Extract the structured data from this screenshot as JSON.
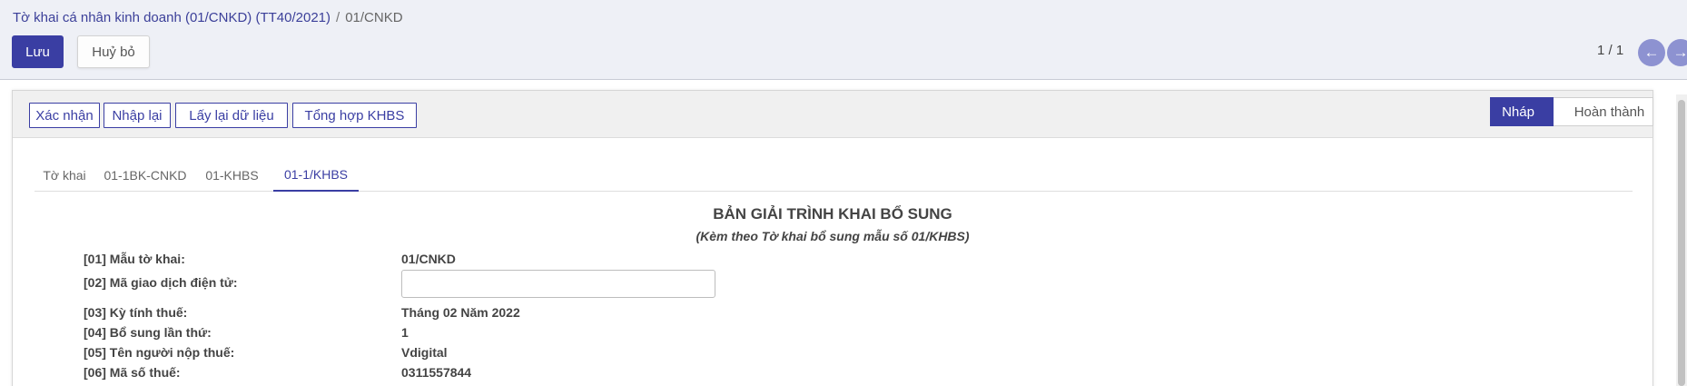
{
  "breadcrumb": {
    "parent": "Tờ khai cá nhân kinh doanh (01/CNKD) (TT40/2021)",
    "separator": "/",
    "current": "01/CNKD"
  },
  "actions": {
    "save": "Lưu",
    "discard": "Huỷ bỏ"
  },
  "pager": {
    "value": "1 / 1",
    "prev_icon": "arrow-left-icon",
    "next_icon": "arrow-right-icon"
  },
  "statusbar": {
    "buttons": [
      "Xác nhận",
      "Nhập lại",
      "Lấy lại dữ liệu",
      "Tổng hợp KHBS"
    ],
    "stages": [
      "Nháp",
      "Hoàn thành"
    ],
    "active_stage": "Nháp"
  },
  "tabs": [
    "Tờ khai",
    "01-1BK-CNKD",
    "01-KHBS",
    "01-1/KHBS"
  ],
  "active_tab": "01-1/KHBS",
  "document": {
    "title": "BẢN GIẢI TRÌNH KHAI BỔ SUNG",
    "subtitle": "(Kèm theo Tờ khai bổ sung mẫu số 01/KHBS)",
    "fields": [
      {
        "label": "[01] Mẫu tờ khai:",
        "value": "01/CNKD"
      },
      {
        "label": "[02] Mã giao dịch điện tử:",
        "value": ""
      },
      {
        "label": "[03] Kỳ tính thuế:",
        "value": "Tháng 02 Năm 2022"
      },
      {
        "label": "[04] Bổ sung lần thứ:",
        "value": "1"
      },
      {
        "label": "[05] Tên người nộp thuế:",
        "value": "Vdigital"
      },
      {
        "label": "[06] Mã số thuế:",
        "value": "0311557844"
      }
    ]
  },
  "colors": {
    "primary": "#3a3ea3",
    "pager_button": "#8d92d1",
    "control_panel_bg": "#eef0f6"
  }
}
